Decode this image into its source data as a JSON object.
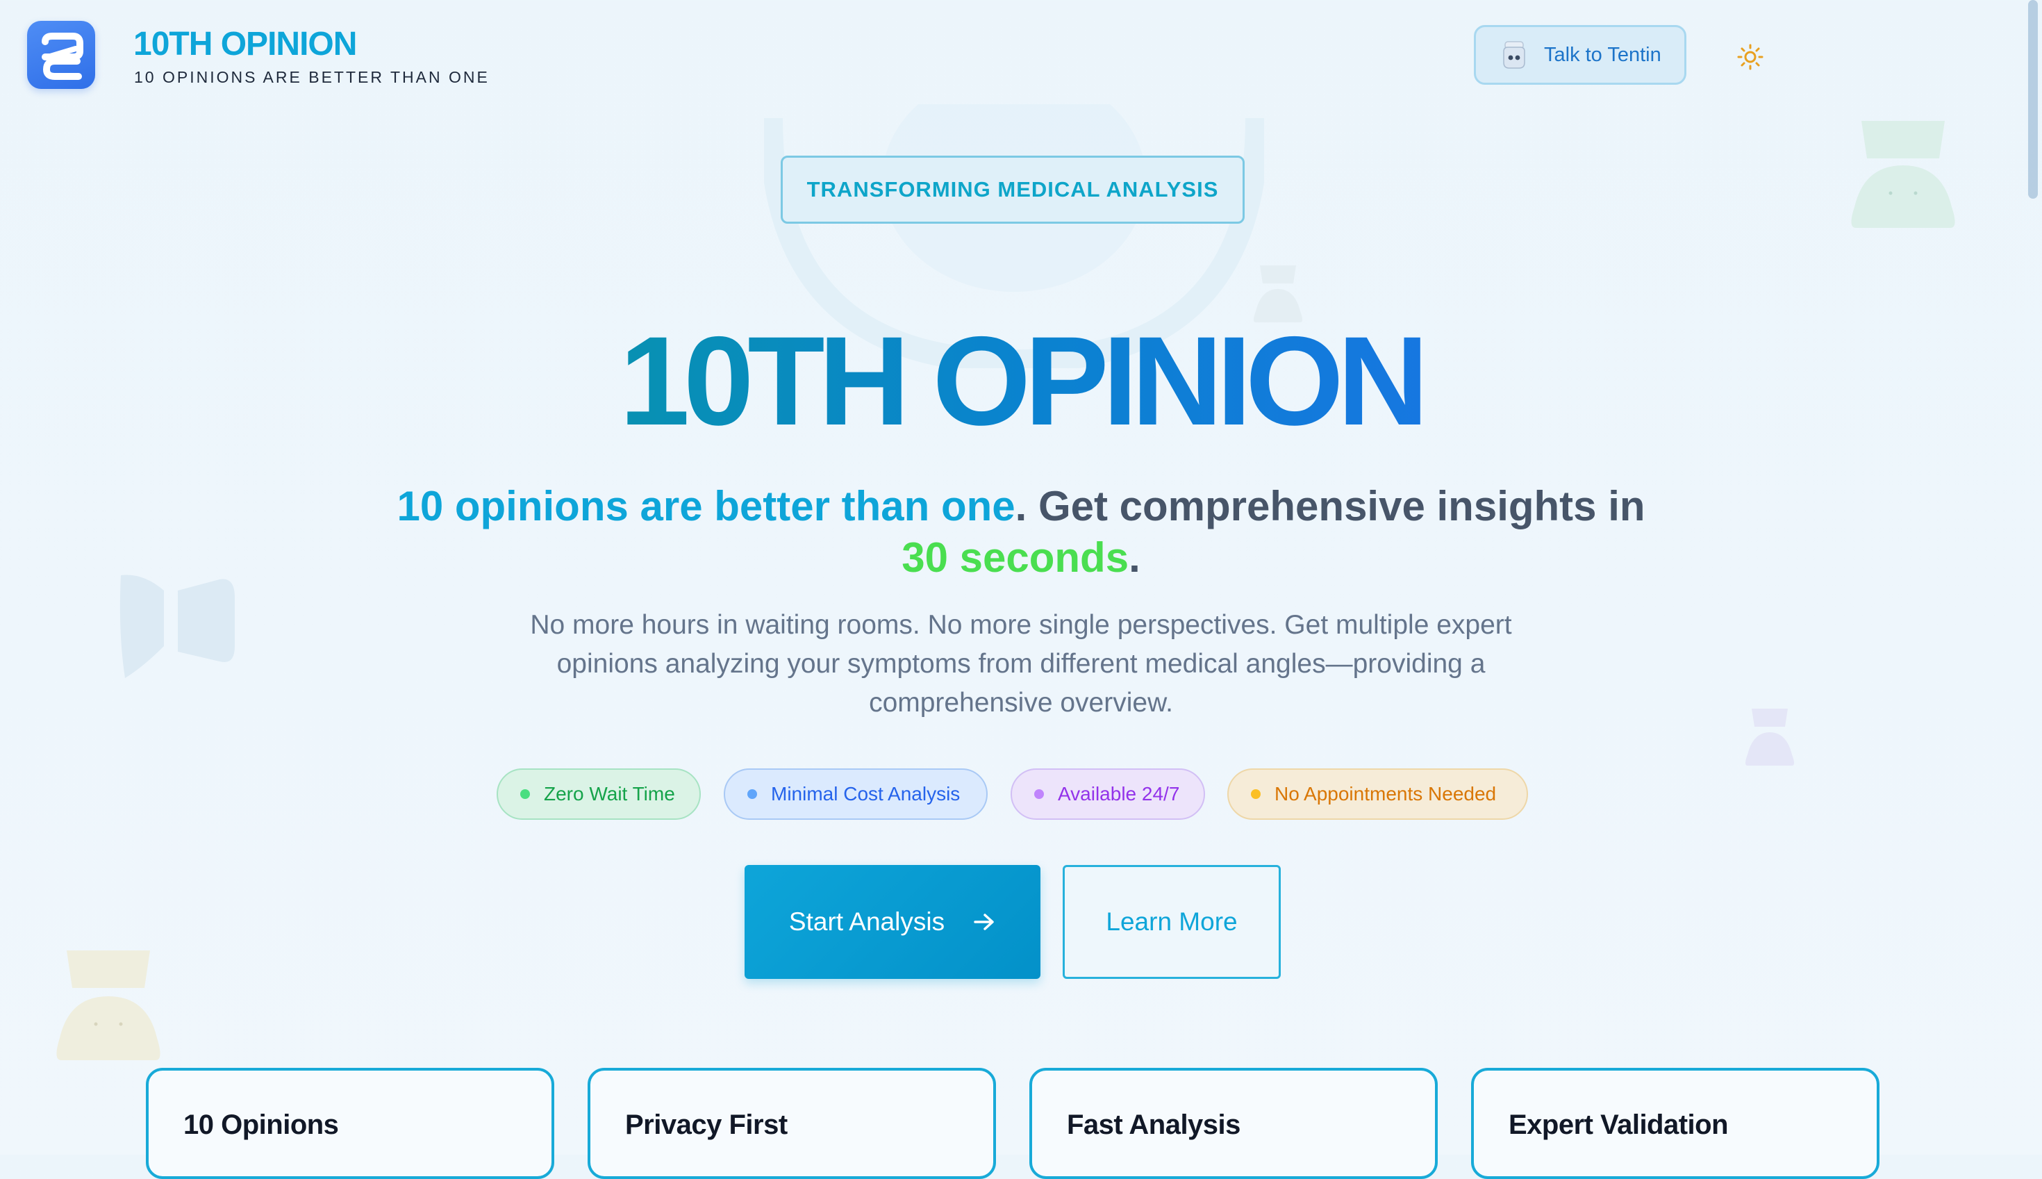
{
  "header": {
    "brand_title": "10TH OPINION",
    "brand_subtitle": "10 OPINIONS ARE BETTER THAN ONE",
    "talk_button_label": "Talk to Tentin",
    "theme_icon": "sun-icon",
    "robot_icon": "robot-avatar-icon",
    "logo_icon": "10th-opinion-logo"
  },
  "hero": {
    "tag_pill": "TRANSFORMING MEDICAL ANALYSIS",
    "title": "10TH OPINION",
    "tagline_highlight": "10 opinions are better than one",
    "tagline_rest": ". Get comprehensive insights in",
    "tagline_time": "30 seconds",
    "tagline_end": ".",
    "description_lines": [
      "No more hours in waiting rooms. No more single perspectives. Get multiple expert",
      "opinions analyzing your symptoms from different medical angles—providing a",
      "comprehensive overview."
    ]
  },
  "features": [
    {
      "label": "Zero Wait Time",
      "color": "#15a34a"
    },
    {
      "label": "Minimal Cost Analysis",
      "color": "#2563eb"
    },
    {
      "label": "Available 24/7",
      "color": "#9333ea"
    },
    {
      "label": "No Appointments Needed",
      "color": "#d97706"
    }
  ],
  "actions": {
    "start_label": "Start Analysis",
    "start_icon": "arrow-right-icon",
    "learn_label": "Learn More"
  },
  "cards": [
    {
      "title": "10 Opinions"
    },
    {
      "title": "Privacy First"
    },
    {
      "title": "Fast Analysis"
    },
    {
      "title": "Expert Validation"
    }
  ],
  "colors": {
    "accent": "#0ea5d9",
    "brand_blue": "#2f6fe8",
    "green": "#4ade50"
  }
}
